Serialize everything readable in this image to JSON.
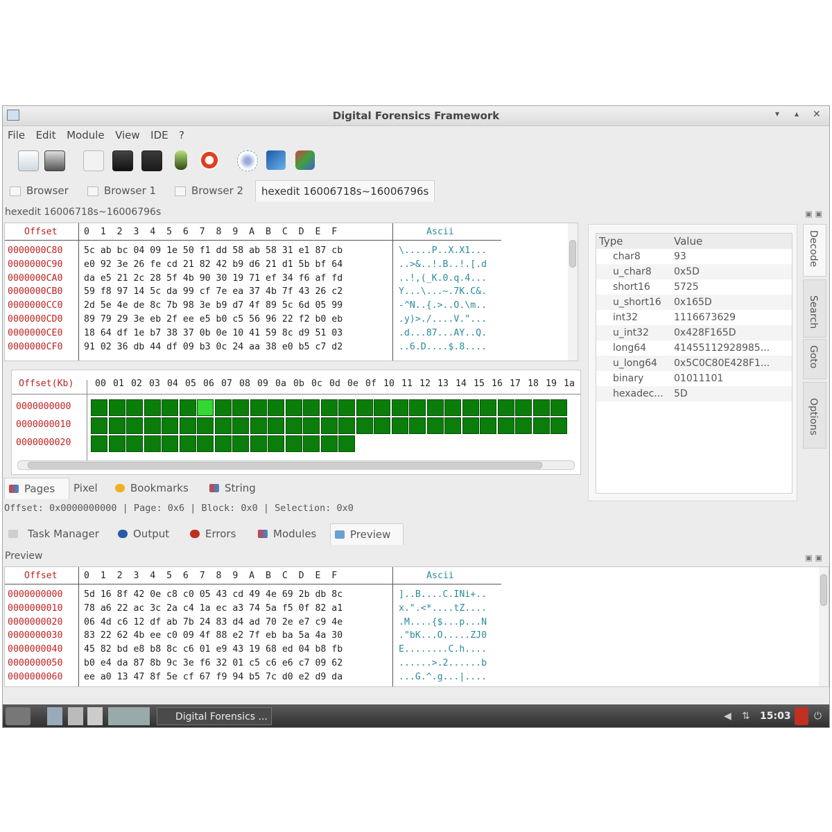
{
  "window": {
    "title": "Digital Forensics Framework"
  },
  "menu": [
    "File",
    "Edit",
    "Module",
    "View",
    "IDE",
    "?"
  ],
  "toolbar_icons": [
    "open-file-icon",
    "module-icon",
    "list-view-icon",
    "monitor-icon",
    "monitor-config-icon",
    "lamp-icon",
    "help-lifebuoy-icon",
    "network-icon",
    "binary-icon",
    "ide-icon"
  ],
  "tabs": [
    "Browser",
    "Browser 1",
    "Browser 2",
    "hexedit 16006718s~16006796s"
  ],
  "hexedit": {
    "dock_title": "hexedit 16006718s~16006796s",
    "offset_header": "Offset",
    "hex_header": "0  1  2  3  4  5  6  7  8  9  A  B  C  D  E  F",
    "ascii_header": "Ascii",
    "rows": [
      {
        "off": "0000000C80",
        "hex": "5c ab bc 04 09 1e 50 f1 dd 58 ab 58 31 e1 87 cb",
        "asc": "\\.....P..X.X1..."
      },
      {
        "off": "0000000C90",
        "hex": "e0 92 3e 26 fe cd 21 82 42 b9 d6 21 d1 5b bf 64",
        "asc": "..>&..!.B..!.[.d"
      },
      {
        "off": "0000000CA0",
        "hex": "da e5 21 2c 28 5f 4b 90 30 19 71 ef 34 f6 af fd",
        "asc": "..!,(_K.0.q.4..."
      },
      {
        "off": "0000000CB0",
        "hex": "59 f8 97 14 5c da 99 cf 7e ea 37 4b 7f 43 26 c2",
        "asc": "Y...\\...~.7K.C&."
      },
      {
        "off": "0000000CC0",
        "hex": "2d 5e 4e de 8c 7b 98 3e b9 d7 4f 89 5c 6d 05 99",
        "asc": "-^N..{.>..O.\\m.."
      },
      {
        "off": "0000000CD0",
        "hex": "89 79 29 3e eb 2f ee e5 b0 c5 56 96 22 f2 b0 eb",
        "asc": ".y)>./....V.\"..."
      },
      {
        "off": "0000000CE0",
        "hex": "18 64 df 1e b7 38 37 0b 0e 10 41 59 8c d9 51 03",
        "asc": ".d...87...AY..Q."
      },
      {
        "off": "0000000CF0",
        "hex": "91 02 36 db 44 df 09 b3 0c 24 aa 38 e0 b5 c7 d2",
        "asc": "..6.D....$.8...."
      }
    ]
  },
  "pagemap": {
    "header_label": "Offset(Kb)",
    "columns": [
      "00",
      "01",
      "02",
      "03",
      "04",
      "05",
      "06",
      "07",
      "08",
      "09",
      "0a",
      "0b",
      "0c",
      "0d",
      "0e",
      "0f",
      "10",
      "11",
      "12",
      "13",
      "14",
      "15",
      "16",
      "17",
      "18",
      "19",
      "1a",
      "1"
    ],
    "rows": [
      "0000000000",
      "0000000010",
      "0000000020"
    ],
    "cells_per_row": [
      27,
      27,
      15
    ],
    "selected_cell": 6
  },
  "decode": {
    "headers": [
      "Type",
      "Value"
    ],
    "rows": [
      [
        "char8",
        "93"
      ],
      [
        "u_char8",
        "0x5D"
      ],
      [
        "short16",
        "5725"
      ],
      [
        "u_short16",
        "0x165D"
      ],
      [
        "int32",
        "1116673629"
      ],
      [
        "u_int32",
        "0x428F165D"
      ],
      [
        "long64",
        "41455112928985..."
      ],
      [
        "u_long64",
        "0x5C0C80E428F1..."
      ],
      [
        "binary",
        "01011101"
      ],
      [
        "hexadec...",
        "5D"
      ]
    ]
  },
  "side_tabs": [
    "Decode",
    "Search",
    "Goto",
    "Options"
  ],
  "view_tabs": [
    "Pages",
    "Pixel",
    "Bookmarks",
    "String"
  ],
  "status": "Offset: 0x0000000000 | Page: 0x6 | Block: 0x0 | Selection: 0x0",
  "bottom_tabs": [
    "Task Manager",
    "Output",
    "Errors",
    "Modules",
    "Preview"
  ],
  "preview": {
    "dock_title": "Preview",
    "offset_header": "Offset",
    "hex_header": "0  1  2  3  4  5  6  7  8  9  A  B  C  D  E  F",
    "ascii_header": "Ascii",
    "rows": [
      {
        "off": "0000000000",
        "hex": "5d 16 8f 42 0e c8 c0 05 43 cd 49 4e 69 2b db 8c",
        "asc": "]..B....C.INi+.."
      },
      {
        "off": "0000000010",
        "hex": "78 a6 22 ac 3c 2a c4 1a ec a3 74 5a f5 0f 82 a1",
        "asc": "x.\".<*....tZ...."
      },
      {
        "off": "0000000020",
        "hex": "06 4d c6 12 df ab 7b 24 83 d4 ad 70 2e e7 c9 4e",
        "asc": ".M....{$...p...N"
      },
      {
        "off": "0000000030",
        "hex": "83 22 62 4b ee c0 09 4f 88 e2 7f eb ba 5a 4a 30",
        "asc": ".\"bK...O.....ZJ0"
      },
      {
        "off": "0000000040",
        "hex": "45 82 bd e8 b8 8c c6 01 e9 43 19 68 ed 04 b8 fb",
        "asc": "E........C.h...."
      },
      {
        "off": "0000000050",
        "hex": "b0 e4 da 87 8b 9c 3e f6 32 01 c5 c6 e6 c7 09 62",
        "asc": "......>.2......b"
      },
      {
        "off": "0000000060",
        "hex": "ee a0 13 47 8f 5e cf 67 f9 94 b5 7c d0 e2 d9 da",
        "asc": "...G.^.g...|...."
      }
    ]
  },
  "taskbar": {
    "window_button": "Digital Forensics ...",
    "clock": "15:03"
  },
  "colors": {
    "offset_red": "#c02020",
    "ascii_teal": "#2a8a9a",
    "page_green": "#0b7d0b",
    "page_selected": "#33d833"
  }
}
